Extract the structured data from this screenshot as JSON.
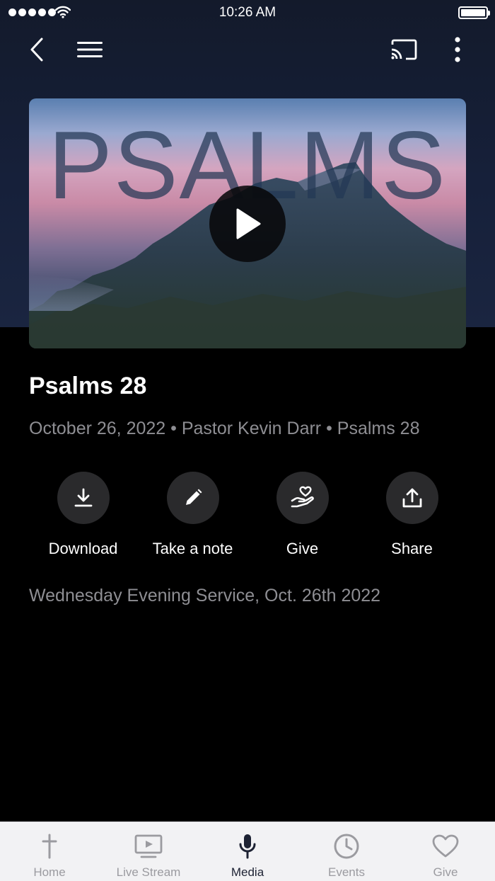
{
  "status_bar": {
    "time": "10:26 AM"
  },
  "nav": {
    "icons": [
      "back-icon",
      "menu-icon",
      "cast-icon",
      "more-vertical-icon"
    ]
  },
  "media": {
    "thumbnail_title": "PSALMS",
    "title": "Psalms 28",
    "meta": "October 26, 2022 • Pastor Kevin Darr • Psalms 28",
    "description": "Wednesday Evening Service, Oct. 26th 2022"
  },
  "actions": [
    {
      "label": "Download",
      "icon": "download-icon"
    },
    {
      "label": "Take a note",
      "icon": "pencil-icon"
    },
    {
      "label": "Give",
      "icon": "give-heart-hand-icon"
    },
    {
      "label": "Share",
      "icon": "share-icon"
    }
  ],
  "tabs": [
    {
      "label": "Home",
      "icon": "cross-icon",
      "active": false
    },
    {
      "label": "Live Stream",
      "icon": "tv-play-icon",
      "active": false
    },
    {
      "label": "Media",
      "icon": "microphone-icon",
      "active": true
    },
    {
      "label": "Events",
      "icon": "clock-icon",
      "active": false
    },
    {
      "label": "Give",
      "icon": "heart-icon",
      "active": false
    }
  ],
  "colors": {
    "tab_active": "#1d2233",
    "tab_inactive": "#9b9ba0",
    "meta_text": "#8e8e93",
    "action_circle": "#2a2a2c"
  }
}
